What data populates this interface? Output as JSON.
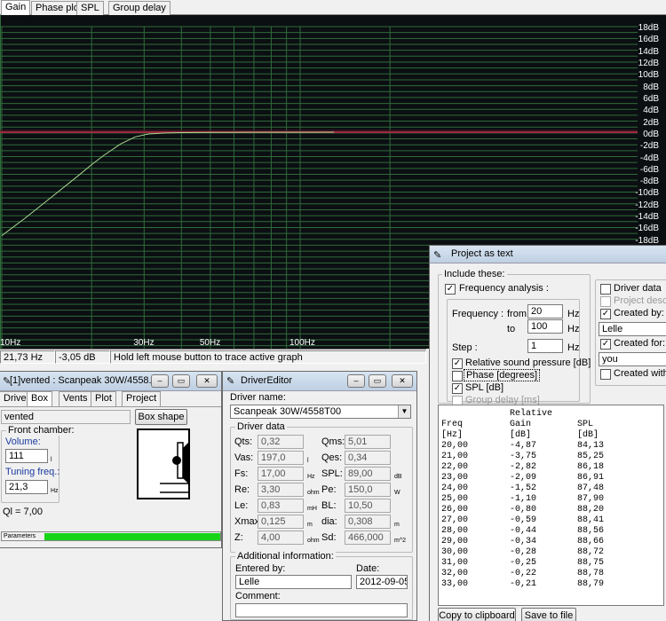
{
  "tabs": [
    "Gain",
    "Phase plot",
    "SPL",
    "Group delay"
  ],
  "graph": {
    "y_labels": [
      "18dB",
      "16dB",
      "14dB",
      "12dB",
      "10dB",
      "8dB",
      "6dB",
      "4dB",
      "2dB",
      "0dB",
      "-2dB",
      "-4dB",
      "-6dB",
      "-8dB",
      "-10dB",
      "-12dB",
      "-14dB",
      "-16dB",
      "-18dB"
    ],
    "x_labels": [
      "10Hz",
      "30Hz",
      "50Hz",
      "100Hz"
    ],
    "colors": {
      "background": "#0b0f12",
      "grid": "#2f6b3a",
      "zero_line": "#a02840",
      "curve": "#a8d890"
    }
  },
  "chart_data": {
    "type": "line",
    "xlabel": "",
    "ylabel": "",
    "xscale": "log",
    "xlim": [
      10,
      250
    ],
    "ylim": [
      -18,
      18
    ],
    "grid": true,
    "series": [
      {
        "x": [
          10,
          12,
          15,
          18,
          20,
          22,
          25,
          28,
          31,
          35,
          40,
          50,
          70,
          100,
          130
        ],
        "y": [
          -17.5,
          -14.5,
          -10.6,
          -7.4,
          -5.5,
          -3.9,
          -2.0,
          -0.8,
          -0.3,
          -0.15,
          -0.08,
          -0.04,
          -0.02,
          -0.01,
          0
        ]
      }
    ]
  },
  "status": {
    "freq": "21,73 Hz",
    "gain": "-3,05 dB",
    "hint": "Hold left mouse button to trace active graph"
  },
  "box_window": {
    "title": "[1]vented : Scanpeak 30W/4558...",
    "tabs": [
      "Driver",
      "Box",
      "Vents",
      "Plot",
      "Project"
    ],
    "box_type": "vented",
    "box_shape_button": "Box shape",
    "front_chamber": "Front chamber:",
    "volume_label": "Volume:",
    "volume_value": "111",
    "volume_unit": "l",
    "tuning_label": "Tuning freq.:",
    "tuning_value": "21,3",
    "tuning_unit": "Hz",
    "ql": "Ql = 7,00",
    "parameters_label": "Parameters"
  },
  "driver_editor": {
    "title": "DriverEditor",
    "driver_name_label": "Driver name:",
    "driver_name": "Scanpeak 30W/4558T00",
    "driver_data_label": "Driver data",
    "params": [
      {
        "label": "Qts:",
        "value": "0,32",
        "unit": ""
      },
      {
        "label": "Qms:",
        "value": "5,01",
        "unit": ""
      },
      {
        "label": "Vas:",
        "value": "197,0",
        "unit": "l"
      },
      {
        "label": "Qes:",
        "value": "0,34",
        "unit": ""
      },
      {
        "label": "Fs:",
        "value": "17,00",
        "unit": "Hz"
      },
      {
        "label": "SPL:",
        "value": "89,00",
        "unit": "dB"
      },
      {
        "label": "Re:",
        "value": "3,30",
        "unit": "ohm"
      },
      {
        "label": "Pe:",
        "value": "150,0",
        "unit": "W"
      },
      {
        "label": "Le:",
        "value": "0,83",
        "unit": "mH"
      },
      {
        "label": "BL:",
        "value": "10,50",
        "unit": ""
      },
      {
        "label": "Xmax:",
        "value": "0,125",
        "unit": "m"
      },
      {
        "label": "dia:",
        "value": "0,308",
        "unit": "m"
      },
      {
        "label": "Z:",
        "value": "4,00",
        "unit": "ohm"
      },
      {
        "label": "Sd:",
        "value": "466,000",
        "unit": "m^2"
      }
    ],
    "additional_info": "Additional information:",
    "entered_by_label": "Entered by:",
    "entered_by": "Lelle",
    "date_label": "Date:",
    "date": "2012-09-05",
    "comment_label": "Comment:"
  },
  "project_text": {
    "title": "Project as text",
    "include_label": "Include these:",
    "freq_analysis": "Frequency analysis :",
    "frequency_label": "Frequency :",
    "from_label": "from",
    "from_value": "20",
    "to_label": "to",
    "to_value": "100",
    "hz": "Hz",
    "step_label": "Step :",
    "step_value": "1",
    "opt_relative_spl": "Relative sound pressure [dB]",
    "opt_phase": "Phase [degrees]",
    "opt_spl": "SPL [dB]",
    "opt_group_delay": "Group delay [ms]",
    "driver_data": "Driver data",
    "project_descr": "Project descripti",
    "created_by_label": "Created by:",
    "created_by": "Lelle",
    "created_for_label": "Created for:",
    "created_for": "you",
    "created_with": "Created with W",
    "table_header1": [
      "",
      "Relative",
      ""
    ],
    "table_header2": [
      "Freq",
      "Gain",
      "SPL"
    ],
    "table_header3": [
      "[Hz]",
      "[dB]",
      "[dB]"
    ],
    "rows": [
      [
        "20,00",
        "-4,87",
        "84,13"
      ],
      [
        "21,00",
        "-3,75",
        "85,25"
      ],
      [
        "22,00",
        "-2,82",
        "86,18"
      ],
      [
        "23,00",
        "-2,09",
        "86,91"
      ],
      [
        "24,00",
        "-1,52",
        "87,48"
      ],
      [
        "25,00",
        "-1,10",
        "87,90"
      ],
      [
        "26,00",
        "-0,80",
        "88,20"
      ],
      [
        "27,00",
        "-0,59",
        "88,41"
      ],
      [
        "28,00",
        "-0,44",
        "88,56"
      ],
      [
        "29,00",
        "-0,34",
        "88,66"
      ],
      [
        "30,00",
        "-0,28",
        "88,72"
      ],
      [
        "31,00",
        "-0,25",
        "88,75"
      ],
      [
        "32,00",
        "-0,22",
        "88,78"
      ],
      [
        "33,00",
        "-0,21",
        "88,79"
      ]
    ],
    "copy_button": "Copy to clipboard",
    "save_button": "Save to file"
  }
}
